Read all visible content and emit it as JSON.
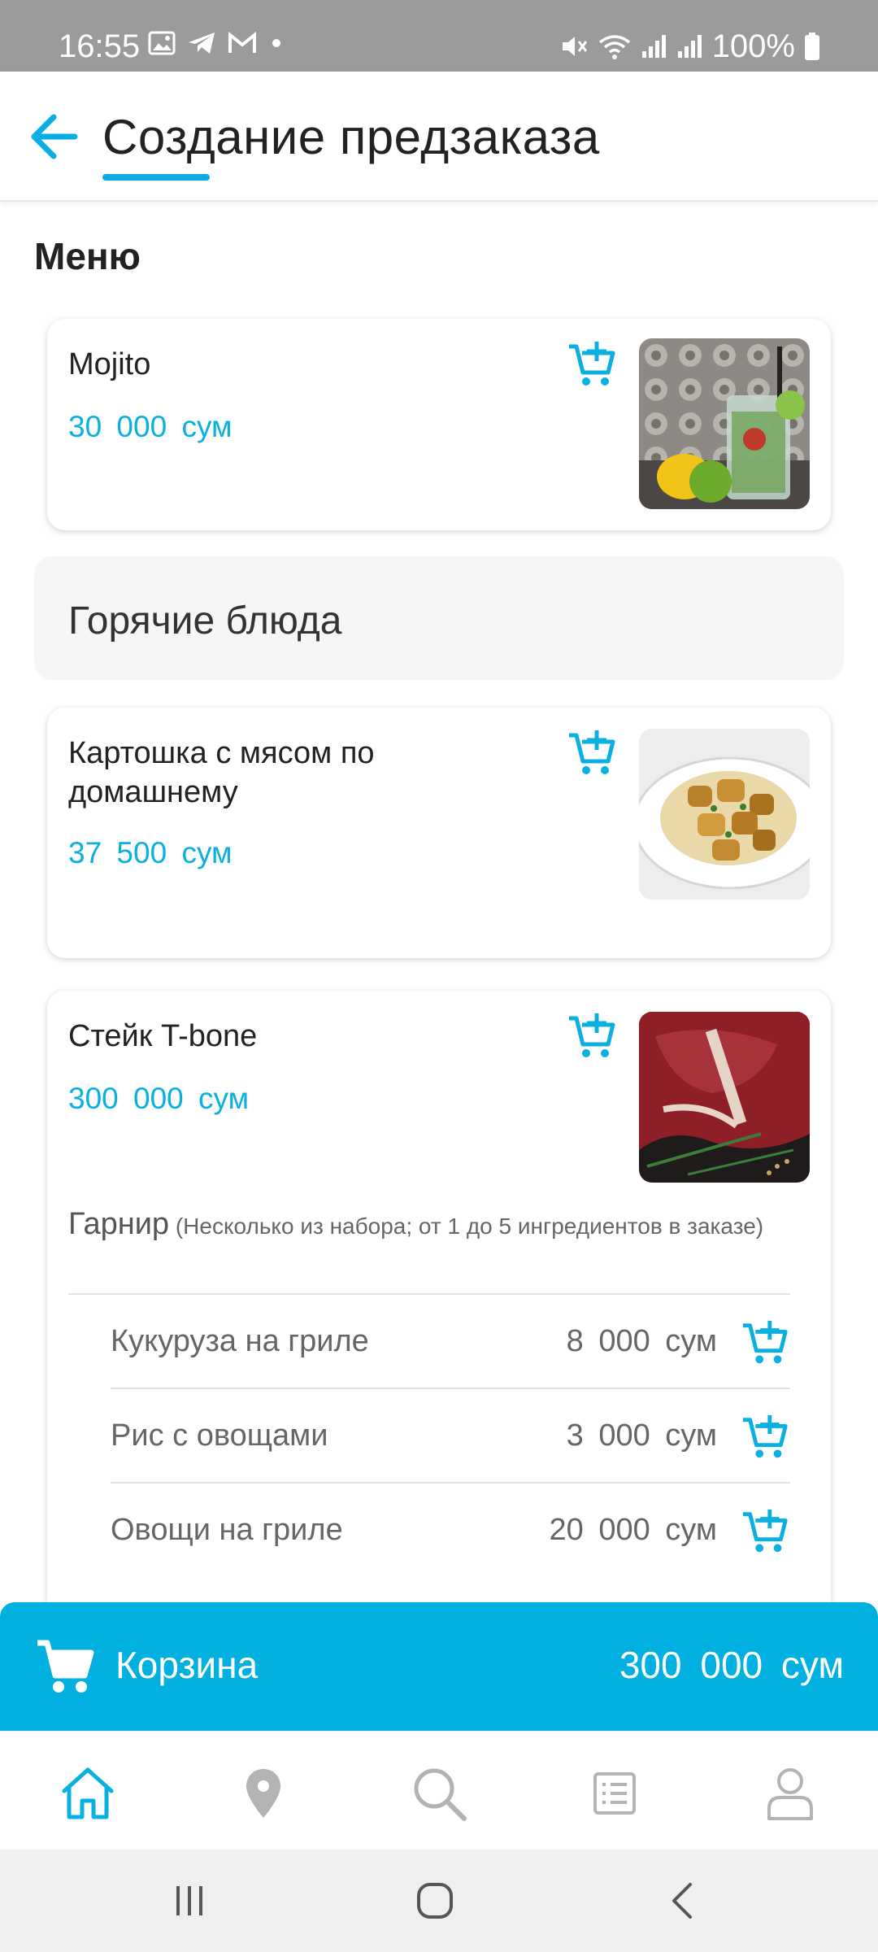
{
  "status_bar": {
    "time": "16:55",
    "battery": "100%",
    "left_icons": [
      "image-icon",
      "telegram-icon",
      "gmail-icon",
      "dot-icon"
    ],
    "right_icons": [
      "mute-icon",
      "wifi-icon",
      "signal-icon",
      "signal-icon",
      "battery-icon"
    ]
  },
  "header": {
    "title": "Создание предзаказа",
    "accent": "#08aee5"
  },
  "menu": {
    "section_title": "Меню",
    "items_top": [
      {
        "name": "Mojito",
        "price": "30 000 сум"
      }
    ],
    "category": "Горячие блюда",
    "items_hot": [
      {
        "name": "Картошка с мясом по домашнему",
        "price": "37 500 сум"
      },
      {
        "name": "Стейк T-bone",
        "price": "300 000 сум"
      }
    ],
    "garnish": {
      "title": "Гарнир",
      "note": "(Несколько из набора; от 1 до 5 ингредиентов в заказе)",
      "options": [
        {
          "name": "Кукуруза на гриле",
          "price": "8 000 сум"
        },
        {
          "name": "Рис с овощами",
          "price": "3 000 сум"
        },
        {
          "name": "Овощи на гриле",
          "price": "20 000 сум"
        }
      ]
    }
  },
  "cart": {
    "label": "Корзина",
    "total": "300 000 сум",
    "color": "#00b0e0"
  },
  "bottom_nav": [
    "home-icon",
    "location-icon",
    "search-icon",
    "list-icon",
    "profile-icon"
  ],
  "system_nav": [
    "recents-icon",
    "home-button-icon",
    "back-icon"
  ]
}
